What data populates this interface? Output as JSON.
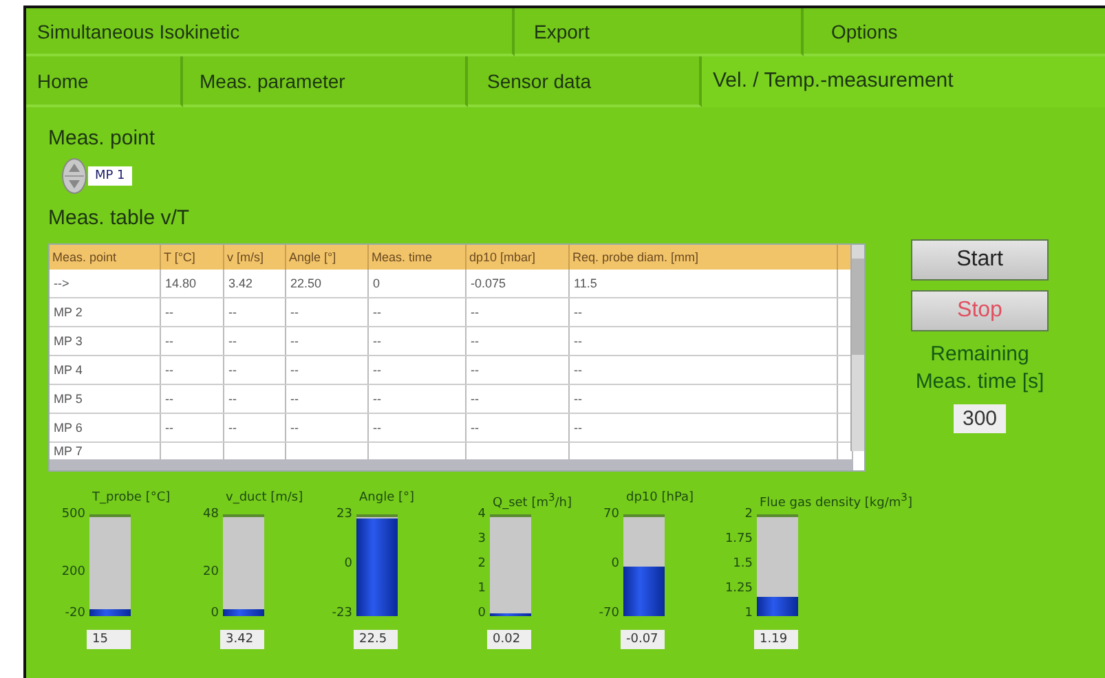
{
  "tab_rows": [
    [
      {
        "label": "Simultaneous Isokinetic",
        "selected": false
      },
      {
        "label": "Export",
        "selected": false
      },
      {
        "label": "Options",
        "selected": false
      }
    ],
    [
      {
        "label": "Home",
        "selected": false
      },
      {
        "label": "Meas. parameter",
        "selected": false
      },
      {
        "label": "Sensor data",
        "selected": false
      },
      {
        "label": "Vel. / Temp.-measurement",
        "selected": true
      }
    ]
  ],
  "meas_point": {
    "label": "Meas. point",
    "value": "MP 1"
  },
  "table": {
    "title": "Meas. table v/T",
    "columns": [
      "Meas. point",
      "T [°C]",
      "v [m/s]",
      "Angle [°]",
      "Meas. time",
      "dp10 [mbar]",
      "Req. probe diam. [mm]"
    ],
    "rows": [
      [
        "-->",
        "14.80",
        "3.42",
        "22.50",
        "0",
        "-0.075",
        "11.5"
      ],
      [
        "MP 2",
        "--",
        "--",
        "--",
        "--",
        "--",
        "--"
      ],
      [
        "MP 3",
        "--",
        "--",
        "--",
        "--",
        "--",
        "--"
      ],
      [
        "MP 4",
        "--",
        "--",
        "--",
        "--",
        "--",
        "--"
      ],
      [
        "MP 5",
        "--",
        "--",
        "--",
        "--",
        "--",
        "--"
      ],
      [
        "MP 6",
        "--",
        "--",
        "--",
        "--",
        "--",
        "--"
      ],
      [
        "MP 7",
        "",
        "",
        "",
        "",
        "",
        ""
      ]
    ]
  },
  "buttons": [
    {
      "label": "Start",
      "kind": "start"
    },
    {
      "label": "Stop",
      "kind": "stop"
    }
  ],
  "remaining": {
    "label": "Remaining Meas. time [s]",
    "value": "300"
  },
  "gauges": [
    {
      "title": "T_probe [°C]",
      "ticks": [
        "500",
        "200",
        "-20"
      ],
      "level": 0.067,
      "value": "15"
    },
    {
      "title": "v_duct [m/s]",
      "ticks": [
        "48",
        "20",
        "0"
      ],
      "level": 0.071,
      "value": "3.42"
    },
    {
      "title": "Angle [°]",
      "ticks": [
        "23",
        "0",
        "-23"
      ],
      "level": 0.99,
      "value": "22.5"
    },
    {
      "title": "Q_set [m$^{3}$/h]",
      "ticks": [
        "4",
        "3",
        "2",
        "1",
        "0"
      ],
      "level": 0.005,
      "value": "0.02"
    },
    {
      "title": "dp10 [hPa]",
      "ticks": [
        "70",
        "0",
        "-70"
      ],
      "level": 0.5,
      "value": "-0.07"
    },
    {
      "title": "Flue gas density [kg/m$^{3}$]",
      "ticks": [
        "2",
        "1.75",
        "1.5",
        "1.25",
        "1"
      ],
      "level": 0.19,
      "value": "1.19"
    }
  ]
}
